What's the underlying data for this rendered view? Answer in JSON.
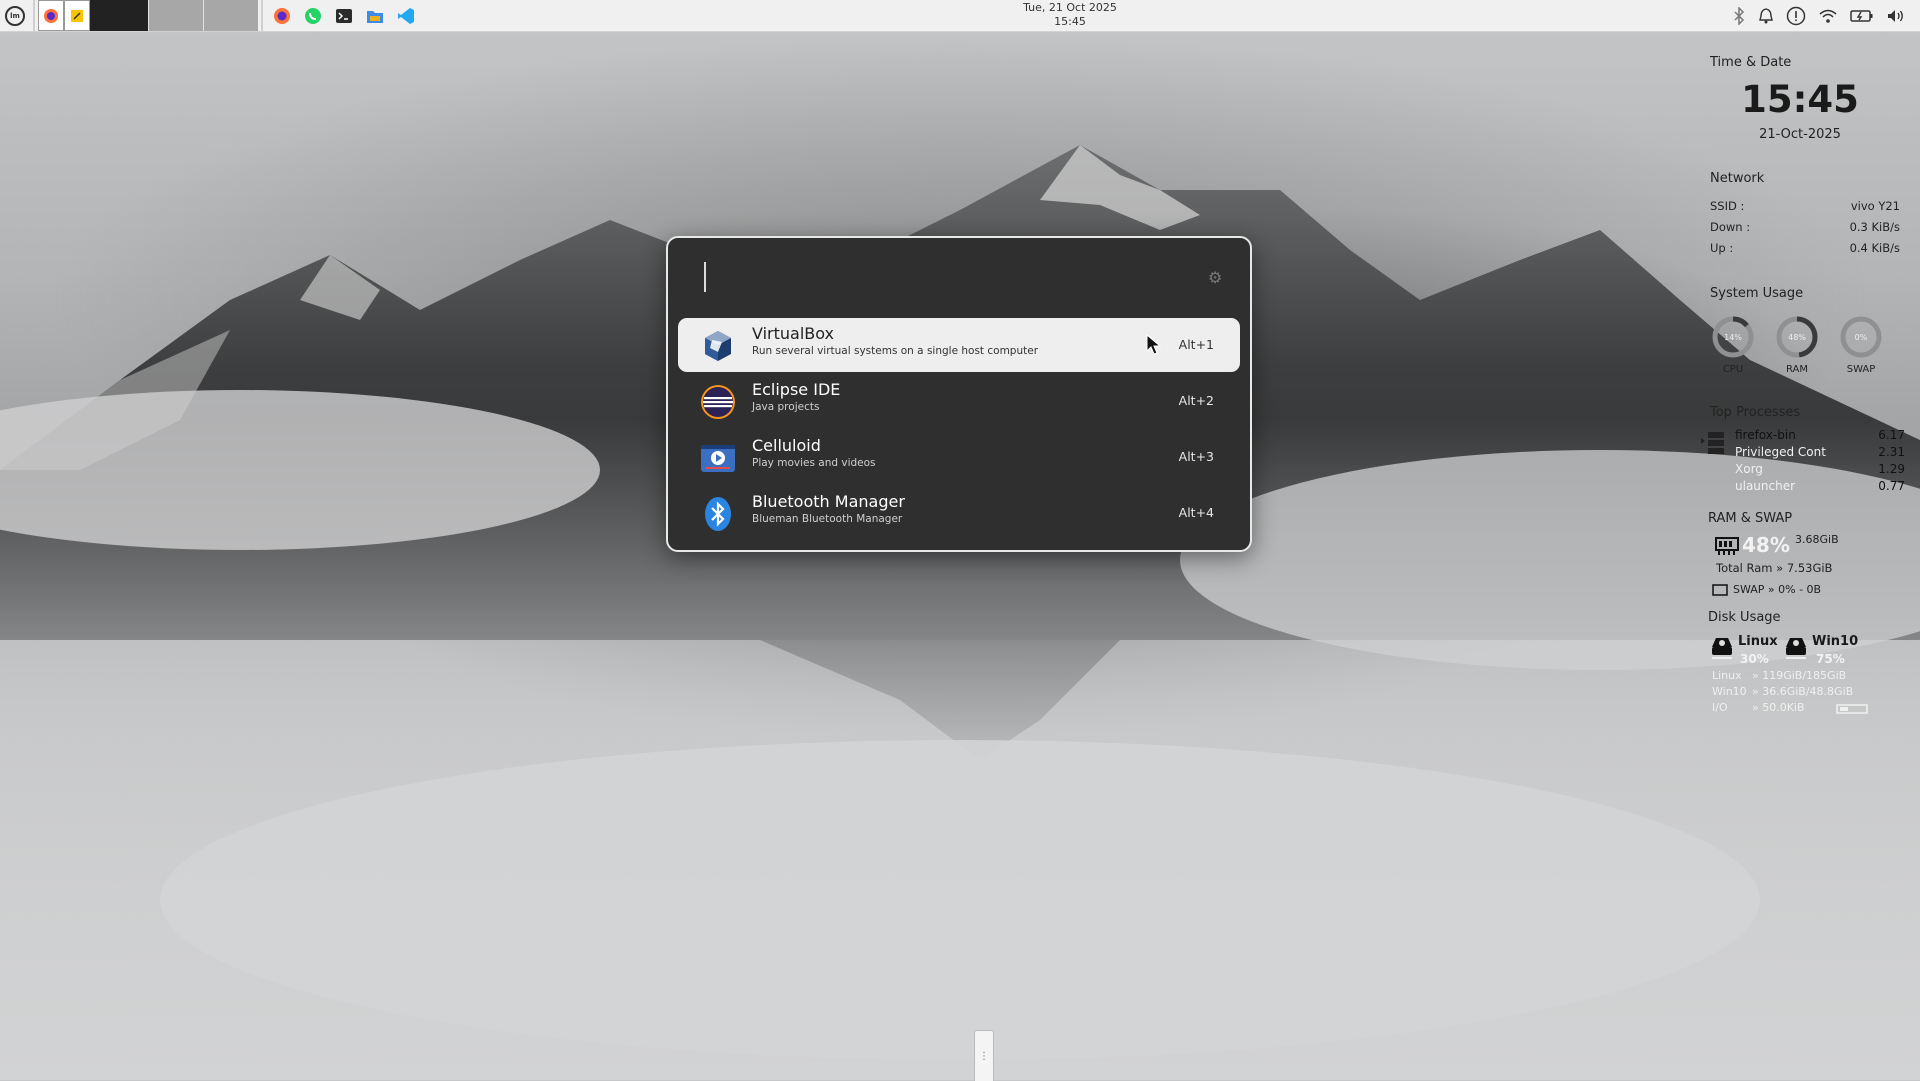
{
  "panel": {
    "clock_date": "Tue, 21 Oct 2025",
    "clock_time": "15:45"
  },
  "launcher": {
    "query": "",
    "results": [
      {
        "name": "VirtualBox",
        "description": "Run several virtual systems on a single host computer",
        "shortcut": "Alt+1",
        "icon": "virtualbox-icon"
      },
      {
        "name": "Eclipse IDE",
        "description": "Java projects",
        "shortcut": "Alt+2",
        "icon": "eclipse-icon"
      },
      {
        "name": "Celluloid",
        "description": "Play movies and videos",
        "shortcut": "Alt+3",
        "icon": "celluloid-icon"
      },
      {
        "name": "Bluetooth Manager",
        "description": "Blueman Bluetooth Manager",
        "shortcut": "Alt+4",
        "icon": "bluetooth-icon"
      }
    ]
  },
  "conky": {
    "time_date_title": "Time & Date",
    "time": "15:45",
    "date": "21-Oct-2025",
    "network_title": "Network",
    "network": {
      "ssid_label": "SSID :",
      "ssid": "vivo Y21",
      "down_label": "Down :",
      "down": "0.3 KiB/s",
      "up_label": "Up :",
      "up": "0.4 KiB/s"
    },
    "system_usage_title": "System Usage",
    "gauges": [
      {
        "label": "CPU",
        "value_text": "14%",
        "value": 14
      },
      {
        "label": "RAM",
        "value_text": "48%",
        "value": 48
      },
      {
        "label": "SWAP",
        "value_text": "0%",
        "value": 0
      }
    ],
    "top_processes_title": "Top Processes",
    "processes": [
      {
        "name": "firefox-bin",
        "value": "6.17"
      },
      {
        "name": "Privileged Cont",
        "value": "2.31"
      },
      {
        "name": "Xorg",
        "value": "1.29"
      },
      {
        "name": "ulauncher",
        "value": "0.77"
      }
    ],
    "ram_swap_title": "RAM & SWAP",
    "ram_percent": "48%",
    "ram_used": "3.68GiB",
    "total_ram": "Total Ram » 7.53GiB",
    "swap_line": "SWAP » 0%  -  0B",
    "disk_usage_title": "Disk Usage",
    "disks": [
      {
        "name": "Linux",
        "percent": "30%"
      },
      {
        "name": "Win10",
        "percent": "75%"
      }
    ],
    "disk_rows": [
      {
        "label": "Linux",
        "value": "» 119GiB/185GiB"
      },
      {
        "label": "Win10",
        "value": "» 36.6GiB/48.8GiB"
      },
      {
        "label": "I/O",
        "value": "» 50.0KiB"
      }
    ]
  },
  "colors": {
    "panel_bg": "#f0f0f0",
    "dialog_bg": "#2f2f2f",
    "selected_bg": "#eeeeee"
  }
}
